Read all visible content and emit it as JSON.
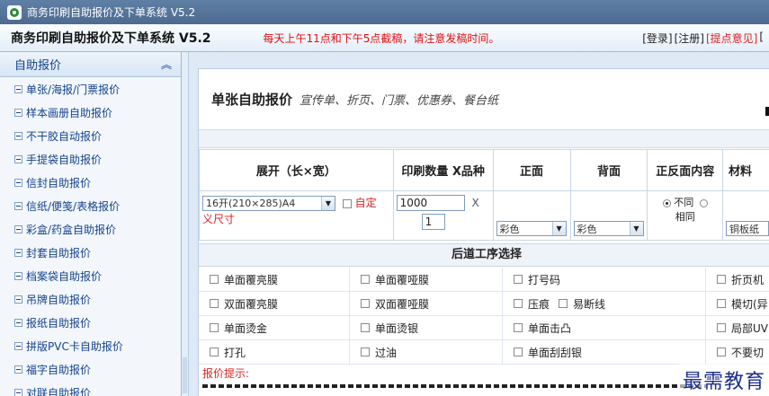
{
  "window": {
    "title": "商务印刷自助报价及下单系统 V5.2"
  },
  "header": {
    "app_name": "商务印刷自助报价及下单系统  V5.2",
    "notice": "每天上午11点和下午5点截稿，请注意发稿时间。",
    "links": {
      "login": "[登录]",
      "register": "[注册]",
      "feedback": "[提点意见]",
      "more": "["
    }
  },
  "sidebar": {
    "title": "自助报价",
    "collapse_glyph": "«",
    "items": [
      "单张/海报/门票报价",
      "样本画册自助报价",
      "不干胶自动报价",
      "手提袋自助报价",
      "信封自助报价",
      "信纸/便笺/表格报价",
      "彩盒/药盒自助报价",
      "封套自助报价",
      "档案袋自助报价",
      "吊牌自助报价",
      "报纸自助报价",
      "拼版PVC卡自助报价",
      "福字自助报价",
      "对联自助报价"
    ]
  },
  "panel": {
    "title": "单张自助报价",
    "subtitle": "宣传单、折页、门票、优惠券、餐台纸"
  },
  "spec_table": {
    "headers": [
      "展开（长×宽）",
      "印刷数量 X品种",
      "正面",
      "背面",
      "正反面内容",
      "材料"
    ],
    "size_value": "16开(210×285)A4",
    "custom_label_1": "自定",
    "custom_label_2": "义尺寸",
    "quantity_value": "1000",
    "times": "X",
    "variety_value": "1",
    "front_value": "彩色",
    "back_value": "彩色",
    "content_opt1": "不同",
    "content_opt2": "相同",
    "material_value": "铜板纸"
  },
  "process": {
    "title": "后道工序选择",
    "rows": [
      [
        "单面覆亮膜",
        "单面覆哑膜",
        "打号码",
        "折页机"
      ],
      [
        "双面覆亮膜",
        "双面覆哑膜",
        "压痕",
        "易断线",
        "模切(异"
      ],
      [
        "单面烫金",
        "单面烫银",
        "单面击凸",
        "局部UV"
      ],
      [
        "打孔",
        "过油",
        "单面刮刮银",
        "不要切"
      ]
    ]
  },
  "hint": {
    "label": "报价提示:"
  },
  "watermark": "最需教育"
}
